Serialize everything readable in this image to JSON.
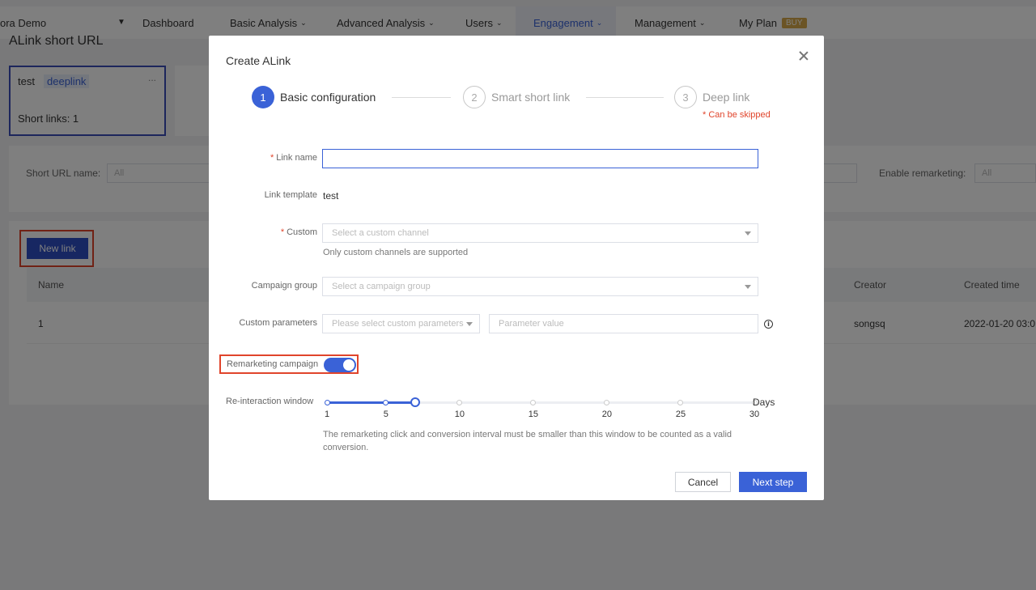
{
  "topnav": {
    "project": "ora Demo",
    "items": [
      {
        "label": "Dashboard"
      },
      {
        "label": "Basic Analysis"
      },
      {
        "label": "Advanced Analysis"
      },
      {
        "label": "Users"
      },
      {
        "label": "Engagement"
      },
      {
        "label": "Management"
      },
      {
        "label": "My Plan"
      }
    ],
    "buy_badge": "BUY"
  },
  "page": {
    "title": "ALink short URL",
    "card": {
      "name": "test",
      "tag": "deeplink",
      "more": "...",
      "count_label": "Short links: 1"
    },
    "filters": {
      "short_url_label": "Short URL name:",
      "short_url_value": "All",
      "remarketing_label": "Enable remarketing:",
      "remarketing_value": "All"
    },
    "new_link_button": "New link",
    "table": {
      "headers": {
        "name": "Name",
        "creator": "Creator",
        "created_time": "Created time"
      },
      "rows": [
        {
          "name": "1",
          "creator": "songsq",
          "created_time": "2022-01-20 03:0"
        }
      ]
    }
  },
  "modal": {
    "title": "Create ALink",
    "steps": [
      {
        "num": "1",
        "label": "Basic configuration",
        "state": "active"
      },
      {
        "num": "2",
        "label": "Smart short link",
        "state": "idle"
      },
      {
        "num": "3",
        "label": "Deep link",
        "state": "idle"
      }
    ],
    "skip_note": "* Can be skipped",
    "form": {
      "link_name_label": "Link name",
      "link_name_value": "",
      "link_template_label": "Link template",
      "link_template_value": "test",
      "custom_label": "Custom",
      "custom_placeholder": "Select a custom channel",
      "custom_hint": "Only custom channels are supported",
      "campaign_group_label": "Campaign group",
      "campaign_group_placeholder": "Select a campaign group",
      "custom_params_label": "Custom parameters",
      "custom_params_placeholder": "Please select custom parameters",
      "param_value_placeholder": "Parameter value",
      "remarketing_label": "Remarketing campaign",
      "remarketing_enabled": true,
      "reinteraction_label": "Re-interaction window",
      "slider_marks": [
        "1",
        "5",
        "10",
        "15",
        "20",
        "25",
        "30"
      ],
      "slider_value_days": 7,
      "days_label": "Days",
      "slider_hint": "The remarketing click and conversion interval must be smaller than this window to be counted as a valid conversion."
    },
    "buttons": {
      "cancel": "Cancel",
      "next": "Next step"
    }
  },
  "colors": {
    "accent": "#3a62d7",
    "highlight": "#e0442b",
    "required": "#e0442b",
    "buy": "#d6a94a"
  }
}
